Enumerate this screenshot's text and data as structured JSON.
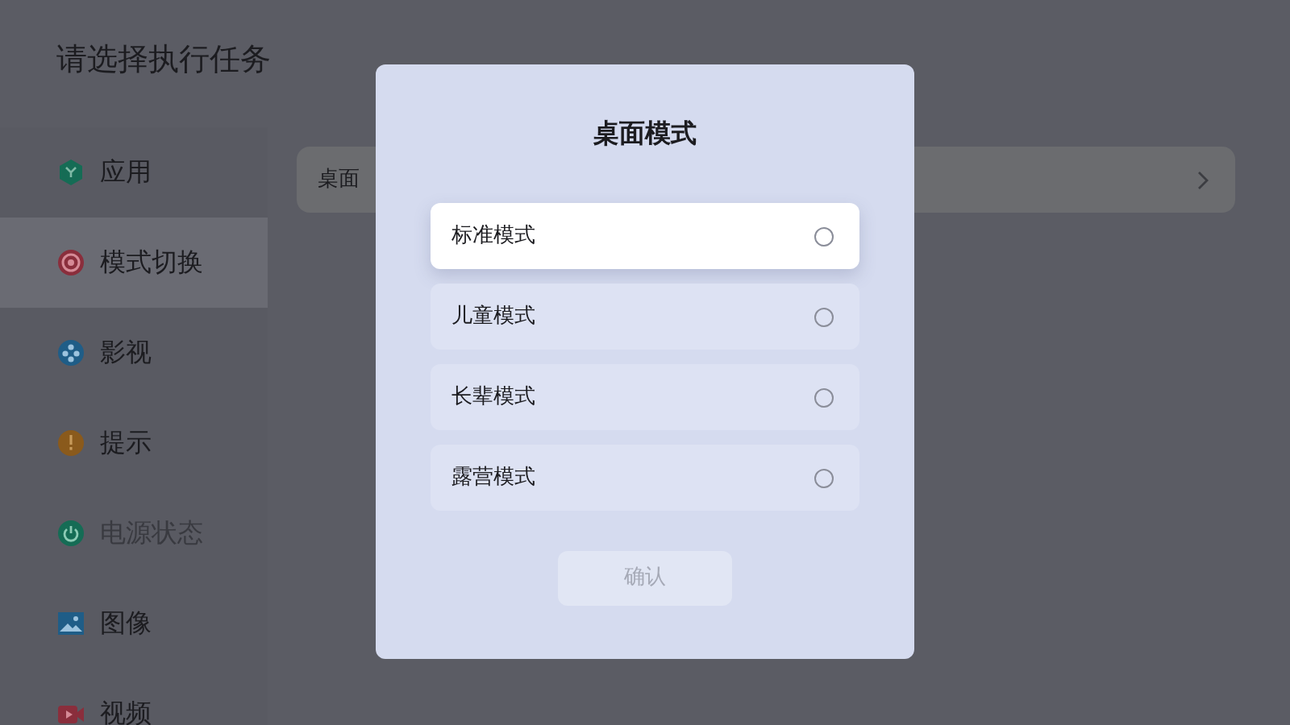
{
  "page_title": "请选择执行任务",
  "sidebar": {
    "items": [
      {
        "label": "应用",
        "kind": "app",
        "selected": false,
        "disabled": false
      },
      {
        "label": "模式切换",
        "kind": "mode",
        "selected": true,
        "disabled": false
      },
      {
        "label": "影视",
        "kind": "film",
        "selected": false,
        "disabled": false
      },
      {
        "label": "提示",
        "kind": "alert",
        "selected": false,
        "disabled": false
      },
      {
        "label": "电源状态",
        "kind": "power",
        "selected": false,
        "disabled": true
      },
      {
        "label": "图像",
        "kind": "image",
        "selected": false,
        "disabled": false
      },
      {
        "label": "视频",
        "kind": "video",
        "selected": false,
        "disabled": false
      }
    ]
  },
  "content_rows": [
    {
      "label": "桌面"
    }
  ],
  "dialog": {
    "title": "桌面模式",
    "options": [
      {
        "label": "标准模式",
        "focused": true,
        "checked": false
      },
      {
        "label": "儿童模式",
        "focused": false,
        "checked": false
      },
      {
        "label": "长辈模式",
        "focused": false,
        "checked": false
      },
      {
        "label": "露营模式",
        "focused": false,
        "checked": false
      }
    ],
    "confirm": {
      "label": "确认",
      "disabled": true
    }
  }
}
